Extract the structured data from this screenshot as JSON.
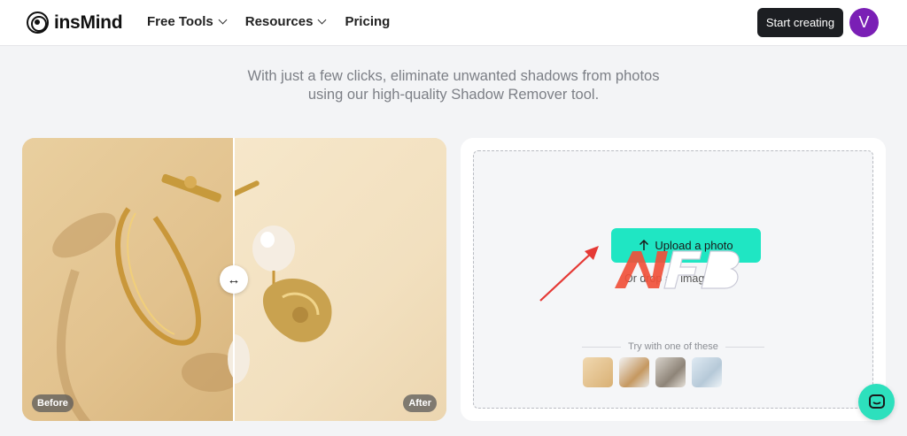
{
  "brand": {
    "name": "insMind"
  },
  "nav": {
    "items": [
      {
        "label": "Free Tools",
        "dropdown": true
      },
      {
        "label": "Resources",
        "dropdown": true
      },
      {
        "label": "Pricing",
        "dropdown": false
      }
    ],
    "cta_label": "Start creating",
    "avatar_initial": "V"
  },
  "hero": {
    "subtitle_line1": "With just a few clicks, eliminate unwanted shadows from photos",
    "subtitle_line2": "using our high-quality Shadow Remover tool."
  },
  "comparison": {
    "before_label": "Before",
    "after_label": "After",
    "handle_glyph": "↔"
  },
  "upload": {
    "button_label": "Upload a photo",
    "button_icon": "upload-arrow-icon",
    "drop_text": "Or drop an image",
    "try_label": "Try with one of these",
    "samples": [
      "sample-earrings",
      "sample-bike",
      "sample-vase",
      "sample-flowers"
    ]
  },
  "colors": {
    "accent": "#1fe6c3",
    "avatar": "#7a1fb5",
    "cta_bg": "#1c1e22",
    "annotation": "#e53935",
    "chat": "#2de0bd"
  }
}
